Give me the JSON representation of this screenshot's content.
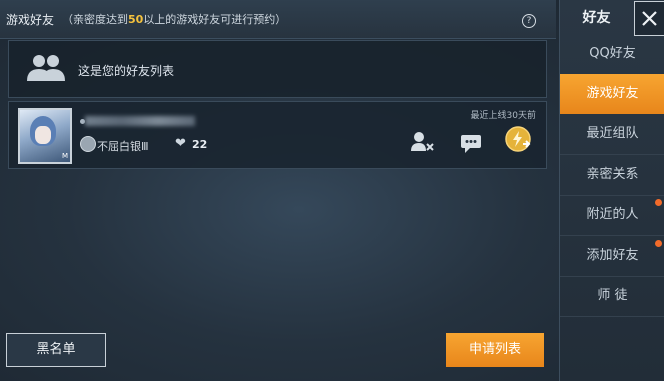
{
  "header": {
    "title": "游戏好友",
    "note_prefix": "（亲密度达到",
    "note_highlight": "50",
    "note_suffix": "以上的游戏好友可进行预约）",
    "help_glyph": "?"
  },
  "friend_list": {
    "header_label": "这是您的好友列表"
  },
  "friends": [
    {
      "avatar_tag": "M",
      "last_online": "最近上线30天前",
      "rank": "不屈白银Ⅲ",
      "heart_glyph": "❤",
      "intimacy": "22"
    }
  ],
  "footer": {
    "blacklist_label": "黑名单",
    "requests_label": "申请列表"
  },
  "sidebar": {
    "title": "好友",
    "items": [
      {
        "label": "QQ好友",
        "active": false,
        "dot": false
      },
      {
        "label": "游戏好友",
        "active": true,
        "dot": false
      },
      {
        "label": "最近组队",
        "active": false,
        "dot": false
      },
      {
        "label": "亲密关系",
        "active": false,
        "dot": false
      },
      {
        "label": "附近的人",
        "active": false,
        "dot": true
      },
      {
        "label": "添加好友",
        "active": false,
        "dot": true
      },
      {
        "label": "师 徒",
        "active": false,
        "dot": false
      }
    ]
  },
  "colors": {
    "accent": "#f39a27",
    "highlight": "#f5c23d",
    "notification_dot": "#f26b2a"
  },
  "icons": [
    "friends-icon",
    "remove-friend-icon",
    "chat-icon",
    "gift-icon",
    "close-icon",
    "help-icon",
    "heart-icon",
    "rank-icon"
  ]
}
